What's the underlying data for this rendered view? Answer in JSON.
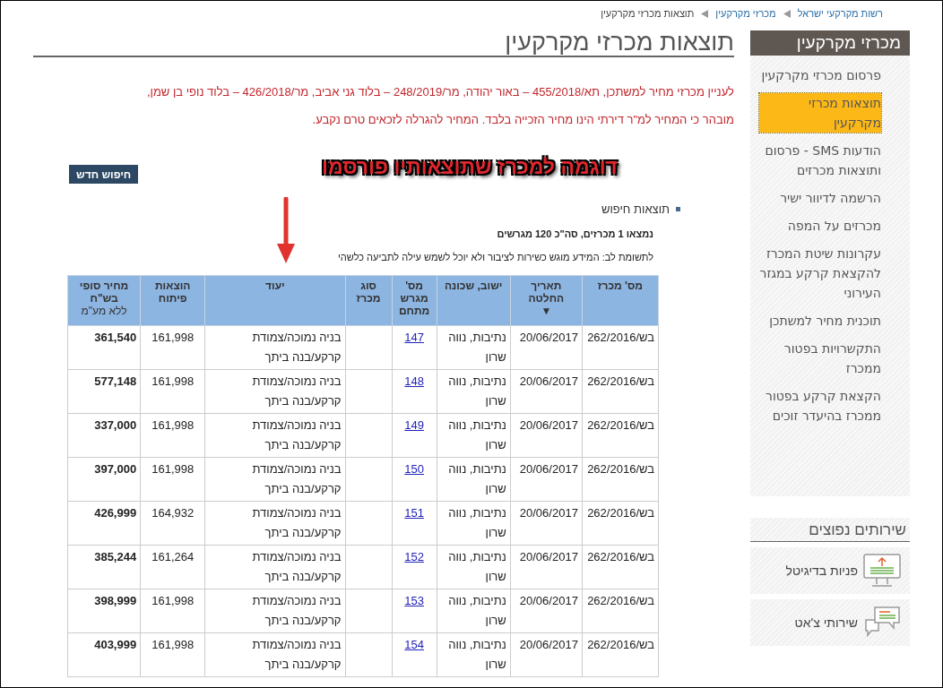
{
  "breadcrumb": [
    {
      "label": "רשות מקרקעי ישראל",
      "current": false
    },
    {
      "label": "מכרזי מקרקעין",
      "current": false
    },
    {
      "label": "תוצאות מכרזי מקרקעין",
      "current": true
    }
  ],
  "page_title": "תוצאות מכרזי מקרקעין",
  "notices": [
    "לעניין מכרזי מחיר למשתכן, תא/455/2018 – באור יהודה, מר/248/2019 – בלוד גני אביב, מר/426/2018 – בלוד נופי בן שמן,",
    "מובהר כי המחיר למ\"ר דירתי הינו מחיר הזכייה בלבד. המחיר להגרלה לזכאים טרם נקבע."
  ],
  "new_search_button": "חיפוש חדש",
  "annotation": {
    "text": "דוגמה למכרז שתוצאותיו פורסמו"
  },
  "results": {
    "heading": "תוצאות חיפוש",
    "summary": "נמצאו 1 מכרזים, סה\"כ 120 מגרשים",
    "note": "לתשומת לב: המידע מוגש כשירות לציבור ולא יוכל לשמש עילה לתביעה כלשהי",
    "columns": [
      {
        "label": "מס' מכרז"
      },
      {
        "label": "תאריך החלטה",
        "sort_mark": "▼"
      },
      {
        "label": "ישוב, שכונה"
      },
      {
        "label": "מס' מגרש מתחם"
      },
      {
        "label": "סוג מכרז"
      },
      {
        "label": "יעוד"
      },
      {
        "label": "הוצאות פיתוח"
      },
      {
        "label": "מחיר סופי בש\"ח",
        "sublabel": "ללא מע\"מ"
      }
    ],
    "rows": [
      {
        "tender": "בש/262/2016",
        "date": "20/06/2017",
        "locality": "נתיבות, נווה שרון",
        "lot": "147",
        "purpose": "בניה נמוכה/צמודת קרקע/בנה ביתך",
        "development": "161,998",
        "price": "361,540"
      },
      {
        "tender": "בש/262/2016",
        "date": "20/06/2017",
        "locality": "נתיבות, נווה שרון",
        "lot": "148",
        "purpose": "בניה נמוכה/צמודת קרקע/בנה ביתך",
        "development": "161,998",
        "price": "577,148"
      },
      {
        "tender": "בש/262/2016",
        "date": "20/06/2017",
        "locality": "נתיבות, נווה שרון",
        "lot": "149",
        "purpose": "בניה נמוכה/צמודת קרקע/בנה ביתך",
        "development": "161,998",
        "price": "337,000"
      },
      {
        "tender": "בש/262/2016",
        "date": "20/06/2017",
        "locality": "נתיבות, נווה שרון",
        "lot": "150",
        "purpose": "בניה נמוכה/צמודת קרקע/בנה ביתך",
        "development": "161,998",
        "price": "397,000"
      },
      {
        "tender": "בש/262/2016",
        "date": "20/06/2017",
        "locality": "נתיבות, נווה שרון",
        "lot": "151",
        "purpose": "בניה נמוכה/צמודת קרקע/בנה ביתך",
        "development": "164,932",
        "price": "426,999"
      },
      {
        "tender": "בש/262/2016",
        "date": "20/06/2017",
        "locality": "נתיבות, נווה שרון",
        "lot": "152",
        "purpose": "בניה נמוכה/צמודת קרקע/בנה ביתך",
        "development": "161,264",
        "price": "385,244"
      },
      {
        "tender": "בש/262/2016",
        "date": "20/06/2017",
        "locality": "נתיבות, נווה שרון",
        "lot": "153",
        "purpose": "בניה נמוכה/צמודת קרקע/בנה ביתך",
        "development": "161,998",
        "price": "398,999"
      },
      {
        "tender": "בש/262/2016",
        "date": "20/06/2017",
        "locality": "נתיבות, נווה שרון",
        "lot": "154",
        "purpose": "בניה נמוכה/צמודת קרקע/בנה ביתך",
        "development": "161,998",
        "price": "403,999"
      }
    ]
  },
  "sidebar": {
    "title": "מכרזי מקרקעין",
    "items": [
      {
        "label": "פרסום מכרזי מקרקעין",
        "selected": false
      },
      {
        "label": "תוצאות מכרזי מקרקעין",
        "selected": true
      },
      {
        "label": "הודעות SMS - פרסום ותוצאות מכרזים",
        "selected": false
      },
      {
        "label": "הרשמה לדיוור ישיר",
        "selected": false
      },
      {
        "label": "מכרזים על המפה",
        "selected": false
      },
      {
        "label": "עקרונות שיטת המכרז להקצאת קרקע במגזר העירוני",
        "selected": false
      },
      {
        "label": "תוכנית מחיר למשתכן",
        "selected": false
      },
      {
        "label": "התקשרויות בפטור ממכרז",
        "selected": false
      },
      {
        "label": "הקצאת קרקע בפטור ממכרז בהיעדר זוכים",
        "selected": false
      }
    ]
  },
  "services": {
    "title": "שירותים נפוצים",
    "items": [
      {
        "label": "פניות בדיגיטל",
        "kind": "digital"
      },
      {
        "label": "שירותי צ'אט",
        "kind": "chat"
      }
    ]
  }
}
